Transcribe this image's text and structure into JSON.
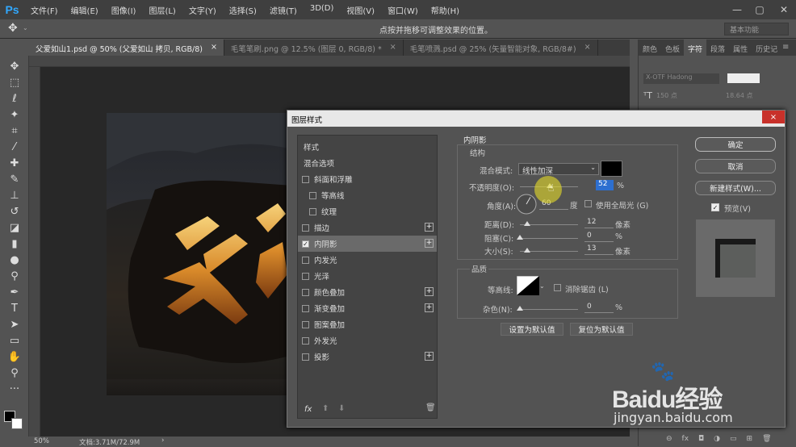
{
  "app": {
    "logo": "Ps"
  },
  "menus": [
    "文件(F)",
    "编辑(E)",
    "图像(I)",
    "图层(L)",
    "文字(Y)",
    "选择(S)",
    "滤镜(T)",
    "3D(D)",
    "视图(V)",
    "窗口(W)",
    "帮助(H)"
  ],
  "options_bar": {
    "hint": "点按并拖移可调整效果的位置。",
    "workspace": "基本功能"
  },
  "doc_tabs": [
    {
      "label": "父爱如山1.psd @ 50% (父爱如山 拷贝, RGB/8)",
      "close": "×"
    },
    {
      "label": "毛笔笔刷.png @ 12.5% (图层 0, RGB/8) *",
      "close": "×"
    },
    {
      "label": "毛笔喷溅.psd @ 25% (矢量智能对象, RGB/8#)",
      "close": "×"
    }
  ],
  "status": {
    "zoom": "50%",
    "doc": "文档:3.71M/72.9M"
  },
  "panel_tabs": [
    "颜色",
    "色板",
    "字符",
    "段落",
    "属性",
    "历史记"
  ],
  "panel_char": {
    "font": "X-OTF Hadong",
    "size": "150 点",
    "leading": "18.64 点"
  },
  "dialog": {
    "title": "图层样式",
    "close": "×",
    "styles_header": "样式",
    "blend_options": "混合选项",
    "styles": [
      {
        "label": "斜面和浮雕",
        "checked": false,
        "plus": false
      },
      {
        "label": "等高线",
        "checked": false,
        "plus": false,
        "indent": true
      },
      {
        "label": "纹理",
        "checked": false,
        "plus": false,
        "indent": true
      },
      {
        "label": "描边",
        "checked": false,
        "plus": true
      },
      {
        "label": "内阴影",
        "checked": true,
        "plus": true,
        "selected": true
      },
      {
        "label": "内发光",
        "checked": false,
        "plus": false
      },
      {
        "label": "光泽",
        "checked": false,
        "plus": false
      },
      {
        "label": "颜色叠加",
        "checked": false,
        "plus": true
      },
      {
        "label": "渐变叠加",
        "checked": false,
        "plus": true
      },
      {
        "label": "图案叠加",
        "checked": false,
        "plus": false
      },
      {
        "label": "外发光",
        "checked": false,
        "plus": false
      },
      {
        "label": "投影",
        "checked": false,
        "plus": true
      }
    ],
    "fx_label": "fx",
    "section_title": "内阴影",
    "structure_title": "结构",
    "blend_mode_label": "混合模式:",
    "blend_mode_value": "线性加深",
    "shadow_color": "#000000",
    "opacity_label": "不透明度(O):",
    "opacity_value": "52",
    "opacity_unit": "%",
    "angle_label": "角度(A):",
    "angle_value": "60",
    "angle_unit": "度",
    "global_light_label": "使用全局光 (G)",
    "distance_label": "距离(D):",
    "distance_value": "12",
    "distance_unit": "像素",
    "choke_label": "阻塞(C):",
    "choke_value": "0",
    "choke_unit": "%",
    "size_label": "大小(S):",
    "size_value": "13",
    "size_unit": "像素",
    "quality_title": "品质",
    "contour_label": "等高线:",
    "antialias_label": "消除锯齿 (L)",
    "noise_label": "杂色(N):",
    "noise_value": "0",
    "noise_unit": "%",
    "set_default": "设置为默认值",
    "reset_default": "复位为默认值",
    "ok": "确定",
    "cancel": "取消",
    "new_style": "新建样式(W)...",
    "preview_label": "预览(V)"
  },
  "sliders": {
    "opacity": 0.52,
    "distance": 0.12,
    "choke": 0.0,
    "size": 0.13,
    "noise": 0.0
  },
  "watermark": {
    "brand": "Baidu经验",
    "url": "jingyan.baidu.com"
  }
}
